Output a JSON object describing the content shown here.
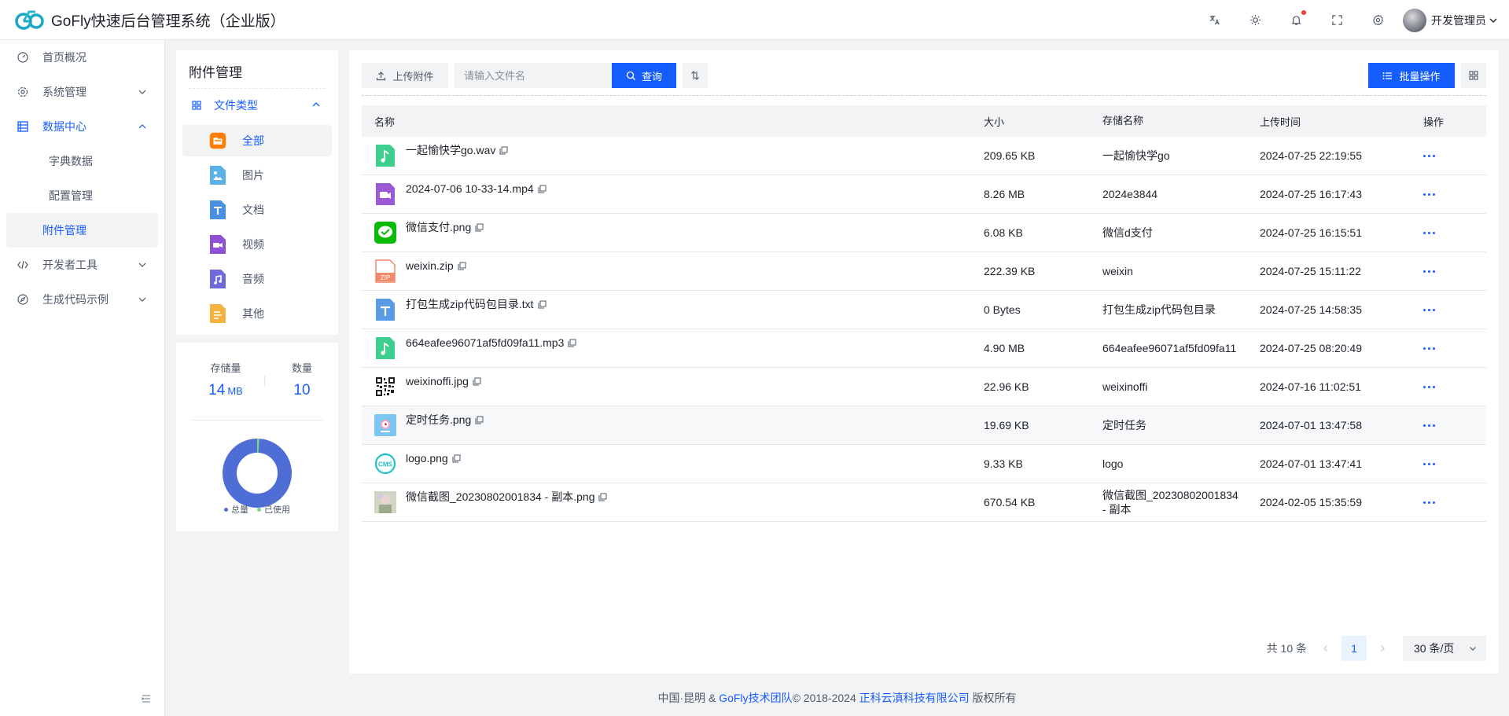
{
  "header": {
    "app_title": "GoFly快速后台管理系统（企业版）",
    "user_name": "开发管理员"
  },
  "sidebar": {
    "items": [
      {
        "label": "首页概况"
      },
      {
        "label": "系统管理"
      },
      {
        "label": "数据中心"
      },
      {
        "label": "开发者工具"
      },
      {
        "label": "生成代码示例"
      }
    ],
    "sub_items": [
      {
        "label": "字典数据"
      },
      {
        "label": "配置管理"
      },
      {
        "label": "附件管理"
      }
    ]
  },
  "category_panel": {
    "title": "附件管理",
    "group_label": "文件类型",
    "items": [
      {
        "label": "全部",
        "icon": "folder-icon",
        "color": "#ff7d00"
      },
      {
        "label": "图片",
        "icon": "image-icon",
        "color": "#5ab0e8"
      },
      {
        "label": "文档",
        "icon": "document-icon",
        "color": "#4a90e2"
      },
      {
        "label": "视频",
        "icon": "video-icon",
        "color": "#8e51d6"
      },
      {
        "label": "音频",
        "icon": "audio-icon",
        "color": "#6f6ad9"
      },
      {
        "label": "其他",
        "icon": "other-icon",
        "color": "#f5b342"
      }
    ]
  },
  "stats": {
    "storage_label": "存储量",
    "storage_value": "14",
    "storage_unit": "MB",
    "count_label": "数量",
    "count_value": "10",
    "legend_total": "总量",
    "legend_used": "已使用",
    "used_fraction": 0.01
  },
  "toolbar": {
    "upload_label": "上传附件",
    "search_placeholder": "请输入文件名",
    "query_label": "查询",
    "batch_label": "批量操作"
  },
  "table": {
    "columns": [
      "名称",
      "大小",
      "存储名称",
      "上传时间",
      "操作"
    ],
    "rows": [
      {
        "name": "一起愉快学go.wav",
        "size": "209.65 KB",
        "store": "一起愉快学go",
        "time": "2024-07-25 22:19:55",
        "icon": "audio-file-icon"
      },
      {
        "name": "2024-07-06 10-33-14.mp4",
        "size": "8.26 MB",
        "store": "2024e3844",
        "time": "2024-07-25 16:17:43",
        "icon": "video-file-icon"
      },
      {
        "name": "微信支付.png",
        "size": "6.08 KB",
        "store": "微信d支付",
        "time": "2024-07-25 16:15:51",
        "icon": "wechat-pay-icon"
      },
      {
        "name": "weixin.zip",
        "size": "222.39 KB",
        "store": "weixin",
        "time": "2024-07-25 15:11:22",
        "icon": "zip-file-icon"
      },
      {
        "name": "打包生成zip代码包目录.txt",
        "size": "0 Bytes",
        "store": "打包生成zip代码包目录",
        "time": "2024-07-25 14:58:35",
        "icon": "text-file-icon"
      },
      {
        "name": "664eafee96071af5fd09fa11.mp3",
        "size": "4.90 MB",
        "store": "664eafee96071af5fd09fa11",
        "time": "2024-07-25 08:20:49",
        "icon": "audio-file-icon"
      },
      {
        "name": "weixinoffi.jpg",
        "size": "22.96 KB",
        "store": "weixinoffi",
        "time": "2024-07-16 11:02:51",
        "icon": "qr-code-icon"
      },
      {
        "name": "定时任务.png",
        "size": "19.69 KB",
        "store": "定时任务",
        "time": "2024-07-01 13:47:58",
        "icon": "timer-task-icon"
      },
      {
        "name": "logo.png",
        "size": "9.33 KB",
        "store": "logo",
        "time": "2024-07-01 13:47:41",
        "icon": "cms-logo-icon"
      },
      {
        "name": "微信截图_20230802001834 - 副本.png",
        "size": "670.54 KB",
        "store": "微信截图_20230802001834 - 副本",
        "time": "2024-02-05 15:35:59",
        "icon": "photo-thumbnail-icon"
      }
    ]
  },
  "pagination": {
    "total_text": "共 10 条",
    "current_page": "1",
    "page_size": "30 条/页"
  },
  "footer": {
    "prefix": "中国·昆明 & ",
    "team": "GoFly技术团队",
    "copyright": "© 2018-2024 ",
    "company": "正科云滇科技有限公司",
    "suffix": " 版权所有"
  },
  "colors": {
    "primary": "#165dff",
    "donut": "#4e6ed6",
    "used_dot": "#7bd67b"
  }
}
